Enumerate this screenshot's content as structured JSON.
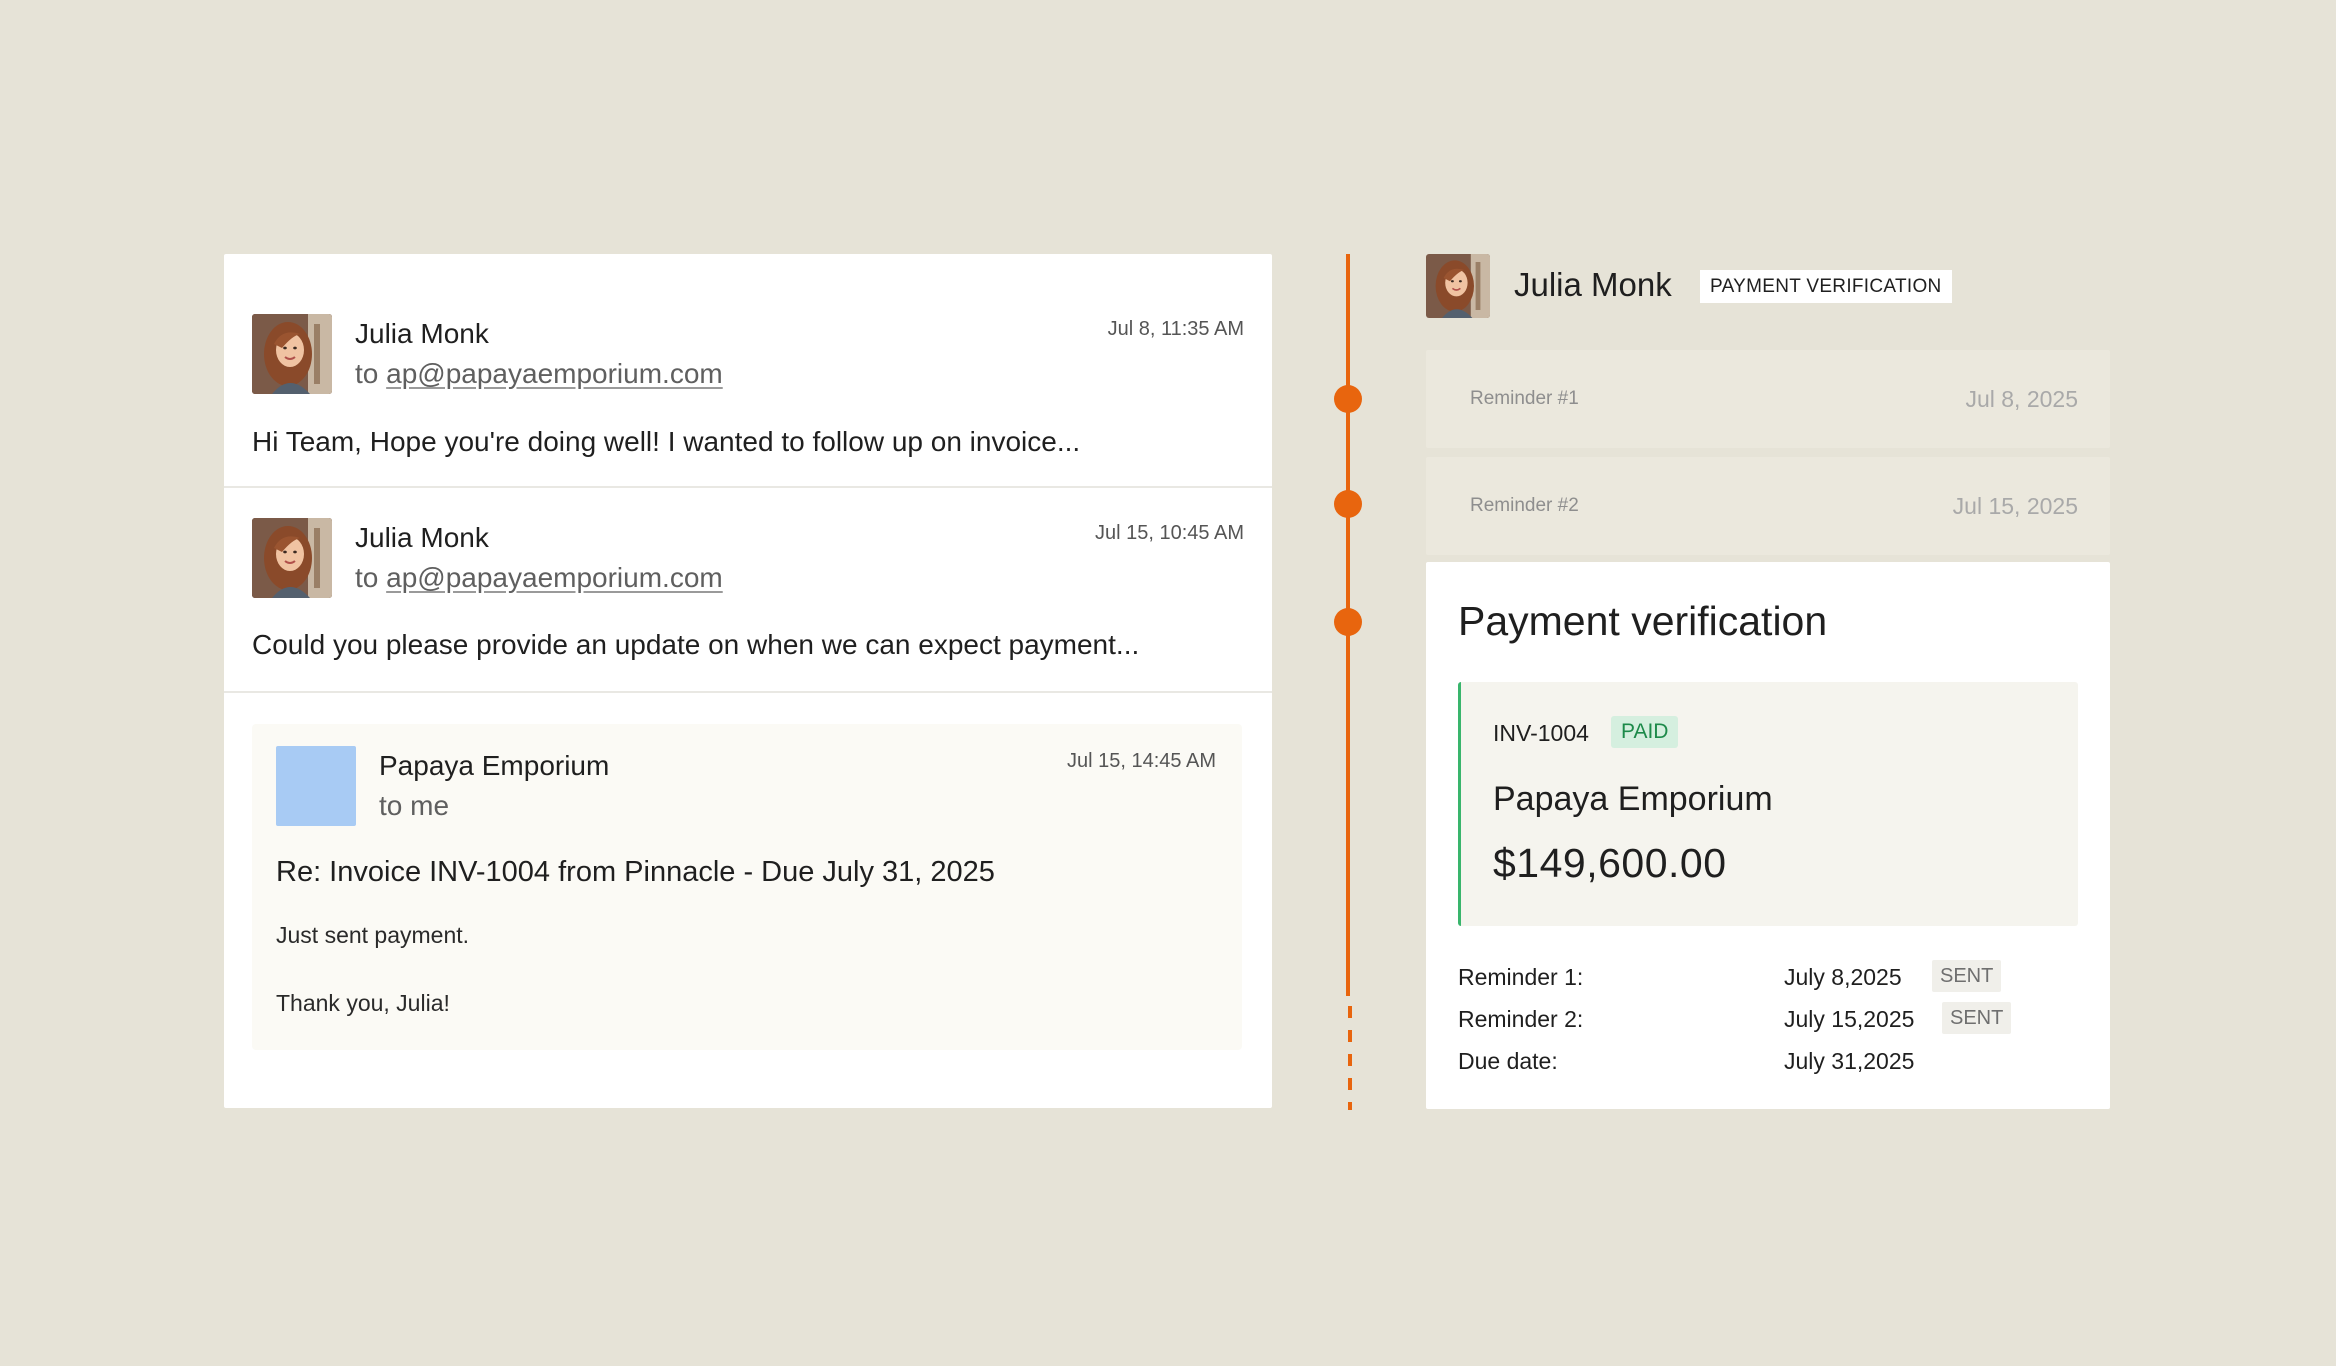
{
  "colors": {
    "background": "#e6e3d7",
    "accent": "#e8650e",
    "paid_green": "#1d8a4a",
    "paid_bg": "#d5efdf",
    "placeholder_avatar": "#a8cbf4"
  },
  "thread": {
    "messages": [
      {
        "sender": "Julia Monk",
        "to_prefix": "to",
        "to_address": "ap@papayaemporium.com",
        "time": "Jul 8, 11:35 AM",
        "preview": "Hi Team, Hope you're doing well! I wanted to follow up on invoice..."
      },
      {
        "sender": "Julia Monk",
        "to_prefix": "to",
        "to_address": "ap@papayaemporium.com",
        "time": "Jul 15, 10:45 AM",
        "preview": "Could you please provide an update on when we can expect payment..."
      }
    ],
    "reply": {
      "sender": "Papaya Emporium",
      "to": "to me",
      "time": "Jul 15, 14:45 AM",
      "subject": "Re: Invoice INV-1004 from Pinnacle - Due July 31, 2025",
      "body_1": "Just sent payment.",
      "body_2": "Thank you, Julia!"
    }
  },
  "header": {
    "name": "Julia Monk",
    "badge": "PAYMENT VERIFICATION"
  },
  "reminders": [
    {
      "label": "Reminder #1",
      "date": "Jul 8, 2025"
    },
    {
      "label": "Reminder #2",
      "date": "Jul 15, 2025"
    }
  ],
  "verification": {
    "title": "Payment verification",
    "invoice_id": "INV-1004",
    "status": "PAID",
    "company": "Papaya Emporium",
    "amount": "$149,600.00",
    "details": [
      {
        "key": "Reminder 1:",
        "value": "July 8,2025",
        "tag": "SENT"
      },
      {
        "key": "Reminder 2:",
        "value": "July 15,2025",
        "tag": "SENT"
      },
      {
        "key": "Due date:",
        "value": "July 31,2025"
      }
    ]
  }
}
